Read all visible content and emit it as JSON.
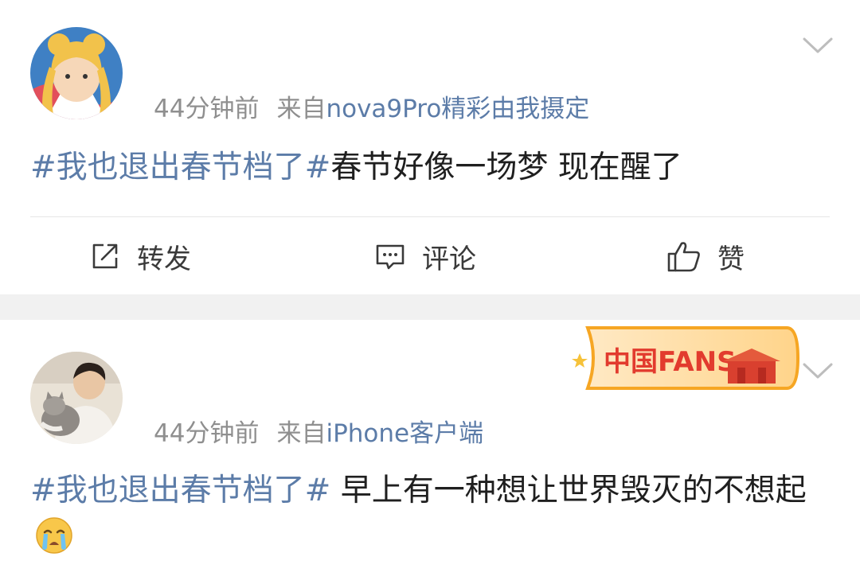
{
  "posts": [
    {
      "time": "44分钟前",
      "from_label": "来自",
      "source": "nova9Pro精彩由我摄定",
      "hashtag": "#我也退出春节档了#",
      "text": "春节好像一场梦  现在醒了",
      "actions": {
        "repost": "转发",
        "comment": "评论",
        "like": "赞"
      }
    },
    {
      "time": "44分钟前",
      "from_label": "来自",
      "source": "iPhone客户端",
      "hashtag": "#我也退出春节档了#",
      "text": " 早上有一种想让世界毁灭的不想起",
      "badge_text": "中国FANS"
    }
  ],
  "colors": {
    "link": "#5c7ca8",
    "meta": "#8f8f8f",
    "divider": "#f1f1f1"
  },
  "icons": [
    "chevron-down-icon",
    "share-icon",
    "comment-icon",
    "thumbs-up-icon",
    "crying-emoji-icon"
  ]
}
